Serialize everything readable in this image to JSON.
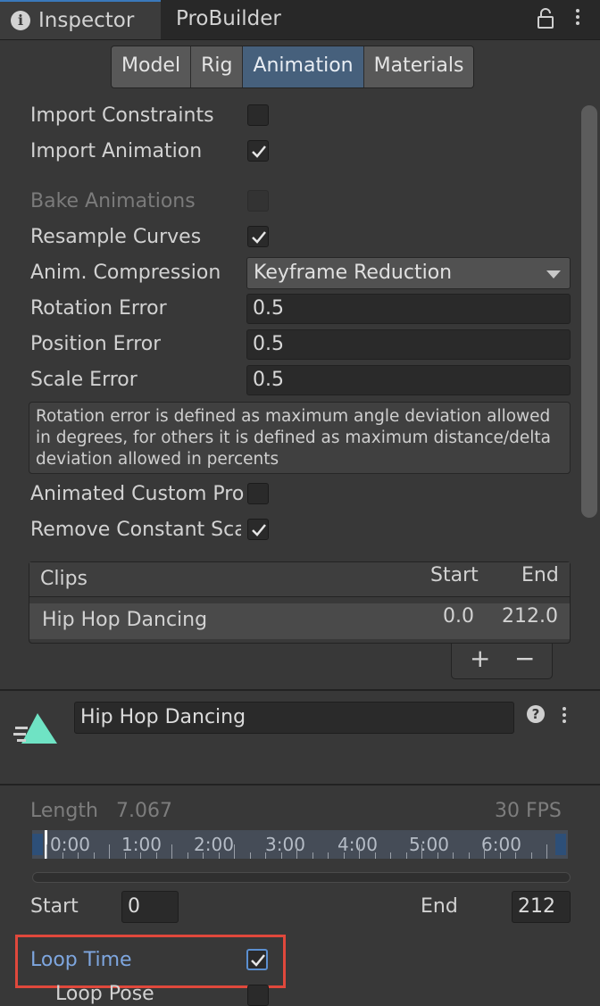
{
  "tabs": {
    "inspector": "Inspector",
    "probuilder": "ProBuilder"
  },
  "subtabs": [
    "Model",
    "Rig",
    "Animation",
    "Materials"
  ],
  "settings": {
    "import_constraints": {
      "label": "Import Constraints",
      "checked": false
    },
    "import_animation": {
      "label": "Import Animation",
      "checked": true
    },
    "bake_animations": {
      "label": "Bake Animations",
      "checked": false,
      "disabled": true
    },
    "resample_curves": {
      "label": "Resample Curves",
      "checked": true
    },
    "anim_compression": {
      "label": "Anim. Compression",
      "value": "Keyframe Reduction"
    },
    "rotation_error": {
      "label": "Rotation Error",
      "value": "0.5"
    },
    "position_error": {
      "label": "Position Error",
      "value": "0.5"
    },
    "scale_error": {
      "label": "Scale Error",
      "value": "0.5"
    },
    "help_text": "Rotation error is defined as maximum angle deviation allowed in degrees, for others it is defined as maximum distance/delta deviation allowed in percents",
    "animated_custom": {
      "label": "Animated Custom Properties",
      "checked": false
    },
    "remove_constant": {
      "label": "Remove Constant Scale Curves",
      "checked": true
    }
  },
  "clips": {
    "headers": {
      "clips": "Clips",
      "start": "Start",
      "end": "End"
    },
    "rows": [
      {
        "name": "Hip Hop Dancing",
        "start": "0.0",
        "end": "212.0"
      }
    ],
    "add": "+",
    "remove": "−"
  },
  "clip_detail": {
    "name": "Hip Hop Dancing",
    "help": "?",
    "length_label": "Length",
    "length_value": "7.067",
    "fps": "30 FPS",
    "timeline_labels": [
      "0:00",
      "1:00",
      "2:00",
      "3:00",
      "4:00",
      "5:00",
      "6:00"
    ],
    "start_label": "Start",
    "start_value": "0",
    "end_label": "End",
    "end_value": "212",
    "loop_time": {
      "label": "Loop Time",
      "checked": true
    },
    "loop_pose": {
      "label": "Loop Pose",
      "checked": false
    }
  },
  "colors": {
    "background": "#383838",
    "active_tab": "#46607c",
    "highlight": "#e0483c",
    "loop_time_text": "#7ea6df",
    "clip_icon": "#6fe3c4"
  }
}
